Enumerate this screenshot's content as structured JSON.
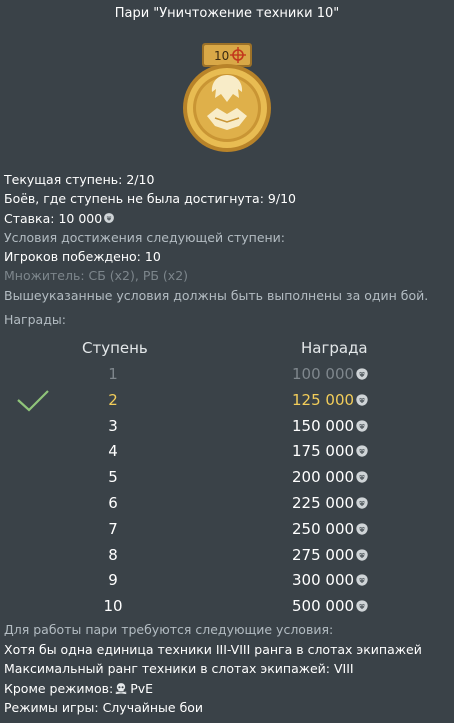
{
  "title": "Пари \"Уничтожение техники 10\"",
  "medal": {
    "level_badge": "10",
    "accent": "#d6a63a"
  },
  "info": {
    "current_stage_label": "Текущая ступень:",
    "current_stage_value": "2/10",
    "battles_label": "Боёв, где ступень не была достигнута:",
    "battles_value": "9/10",
    "bet_label": "Ставка:",
    "bet_value": "10 000",
    "conditions_heading": "Условия достижения следующей ступени:",
    "players_defeated_label": "Игроков побеждено:",
    "players_defeated_value": "10",
    "multiplier_text": "Множитель: СБ (x2), РБ (x2)",
    "single_battle_note": "Вышеуказанные условия должны быть выполнены за один бой."
  },
  "rewards": {
    "label": "Награды:",
    "col_step": "Ступень",
    "col_reward": "Награда",
    "completed_stage": 1,
    "current_stage": 2,
    "rows": [
      {
        "step": "1",
        "reward": "100 000"
      },
      {
        "step": "2",
        "reward": "125 000"
      },
      {
        "step": "3",
        "reward": "150 000"
      },
      {
        "step": "4",
        "reward": "175 000"
      },
      {
        "step": "5",
        "reward": "200 000"
      },
      {
        "step": "6",
        "reward": "225 000"
      },
      {
        "step": "7",
        "reward": "250 000"
      },
      {
        "step": "8",
        "reward": "275 000"
      },
      {
        "step": "9",
        "reward": "300 000"
      },
      {
        "step": "10",
        "reward": "500 000"
      }
    ]
  },
  "footer": {
    "requirements_heading": "Для работы пари требуются следующие условия:",
    "req_vehicle": "Хотя бы одна единица техники III-VIII ранга в слотах экипажей",
    "max_rank_label": "Максимальный ранг техники в слотах экипажей:",
    "max_rank_value": "VIII",
    "except_modes_label": "Кроме режимов:",
    "except_modes_value": "PvE",
    "game_modes_label": "Режимы игры:",
    "game_modes_value": "Случайные бои"
  },
  "colors": {
    "background": "#3a4248",
    "current": "#f2cd5a",
    "completed": "#7f878d",
    "check": "#8fc47a"
  },
  "icons": {
    "currency": "lion-icon",
    "check": "check-icon",
    "pve": "skull-icon"
  }
}
